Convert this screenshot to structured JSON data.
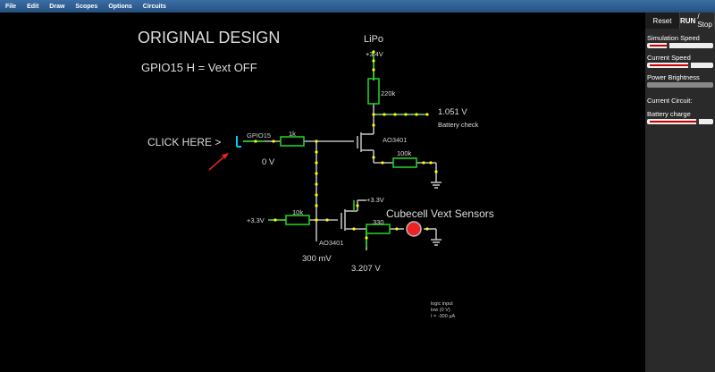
{
  "menu": {
    "items": [
      "File",
      "Edit",
      "Draw",
      "Scopes",
      "Options",
      "Circuits"
    ]
  },
  "canvas": {
    "title": "ORIGINAL DESIGN",
    "subtitle": "GPIO15 H = Vext OFF",
    "click_hint": "CLICK HERE >",
    "logic_symbol": "L",
    "labels": {
      "lipo": "LiPo",
      "v34_top": "+3.4V",
      "r220k": "220k",
      "v1051": "1.051 V",
      "battery_check": "Battery check",
      "gpio15": "GPIO15",
      "r1k": "1k",
      "ao3401_a": "AO3401",
      "zero_v": "0 V",
      "r100k": "100k",
      "v33_right": "+3.3V",
      "v33_left": "+3.3V",
      "r10k": "10k",
      "r330": "330",
      "ao3401_b": "AO3401",
      "cubecell": "Cubecell Vext Sensors",
      "v300mv": "300 mV",
      "v3207": "3.207 V",
      "info_1": "logic input",
      "info_2": "low (0 V)",
      "info_3": "I = -300 µA"
    },
    "colors": {
      "wire": "#bbbbbb",
      "green": "#22cc22",
      "node": "#ffff00",
      "led": "#ee2222",
      "arrow": "#dd2222",
      "cyan": "#00ccff"
    }
  },
  "sidebar": {
    "reset_label": "Reset",
    "run_label": "RUN",
    "stop_label": "/ Stop",
    "sim_speed_label": "Simulation Speed",
    "sim_speed_value": 0.3,
    "current_speed_label": "Current Speed",
    "current_speed_value": 0.65,
    "power_brightness_label": "Power Brightness",
    "current_circuit_label": "Current Circuit:",
    "battery_charge_label": "Battery charge",
    "battery_charge_value": 0.78
  }
}
